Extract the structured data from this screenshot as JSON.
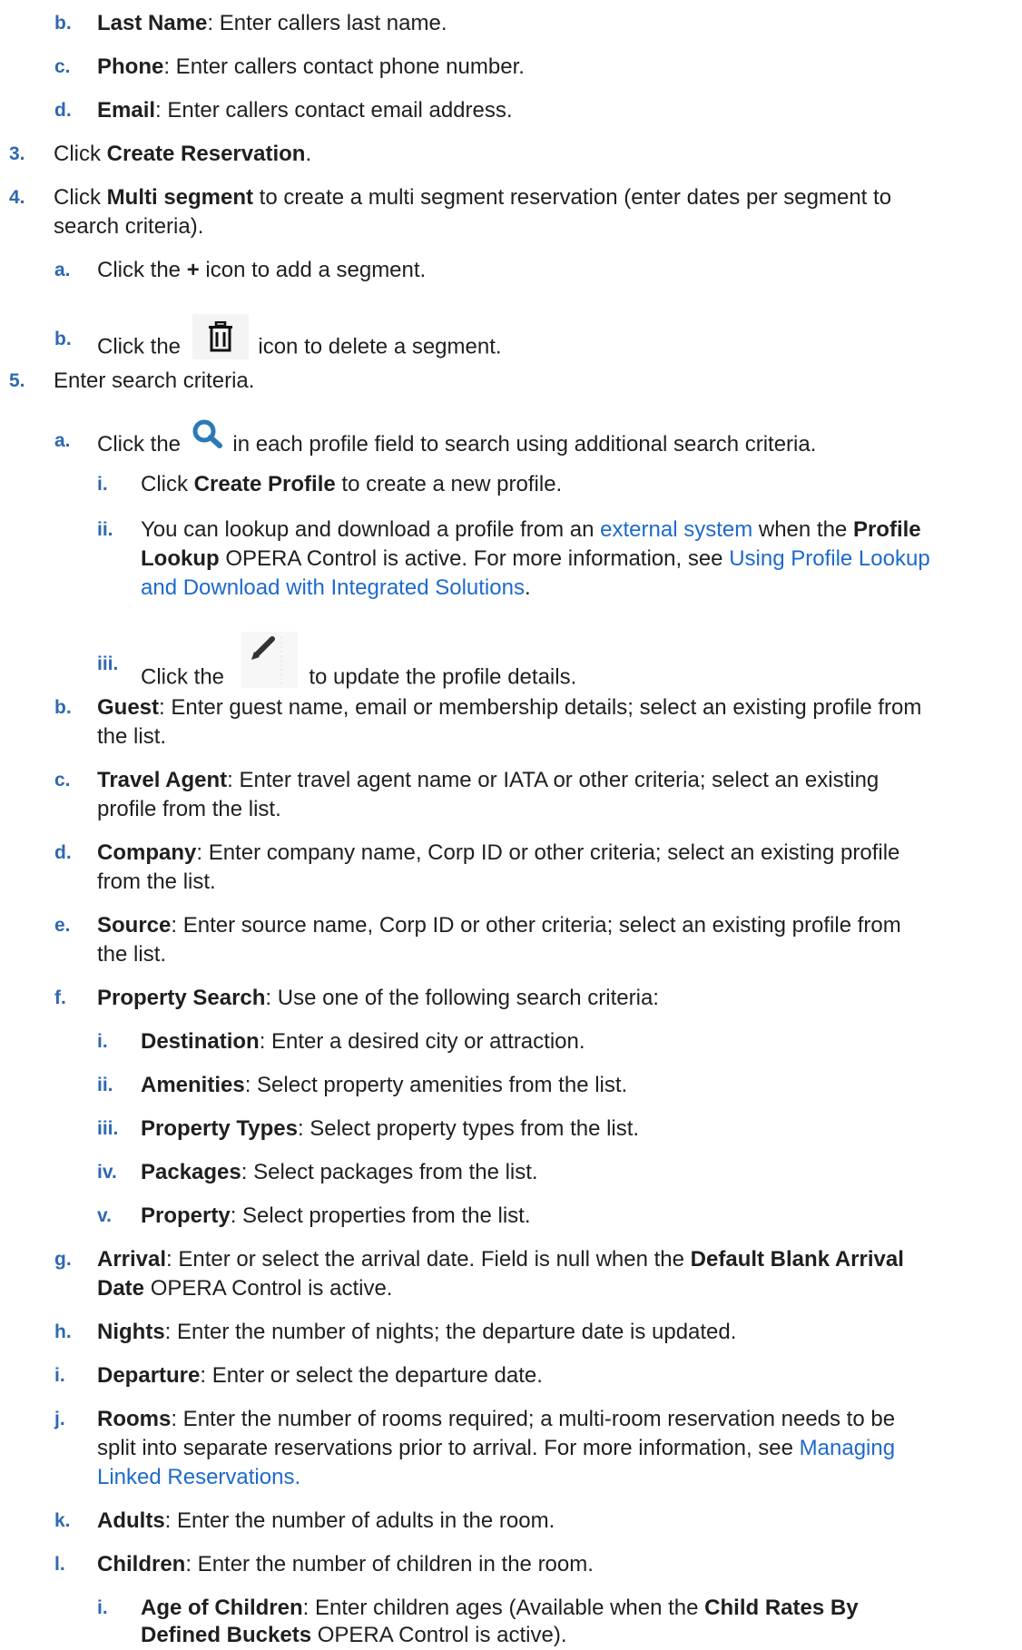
{
  "items": {
    "b_last": {
      "marker": "b.",
      "label": "Last Name",
      "text": ": Enter callers last name."
    },
    "c_phone": {
      "marker": "c.",
      "label": "Phone",
      "text": ": Enter callers contact phone number."
    },
    "d_email": {
      "marker": "d.",
      "label": "Email",
      "text": ": Enter callers contact email address."
    },
    "s3": {
      "marker": "3.",
      "pre": "Click ",
      "label": "Create Reservation",
      "post": "."
    },
    "s4": {
      "marker": "4.",
      "pre": "Click ",
      "label": "Multi segment",
      "post": " to create a multi segment reservation (enter dates per segment to",
      "line2": "search criteria)."
    },
    "s4a": {
      "marker": "a.",
      "pre": "Click the ",
      "label": "+",
      "post": " icon to add a segment."
    },
    "s4b": {
      "marker": "b.",
      "pre": "Click the",
      "post": "icon to delete a segment.",
      "icon": "trash-icon"
    },
    "s5": {
      "marker": "5.",
      "text": "Enter search criteria."
    },
    "s5a": {
      "marker": "a.",
      "pre": "Click the",
      "post": "in each profile field to search using additional search criteria.",
      "icon": "search-icon"
    },
    "s5ai": {
      "marker": "i.",
      "pre": "Click ",
      "label": "Create Profile",
      "post": " to create a new profile."
    },
    "s5aii": {
      "marker": "ii.",
      "l1_pre": "You can lookup and download a profile from an ",
      "l1_link": "external system",
      "l1_mid": " when the ",
      "l1_bold": "Profile",
      "l2_bold": "Lookup",
      "l2_mid": " OPERA Control is active. For more information, see ",
      "l2_link": "Using Profile Lookup",
      "l3_link": "and Download with Integrated Solutions",
      "l3_post": "."
    },
    "s5aiii": {
      "marker": "iii.",
      "pre": "Click the",
      "post": "to update the profile details.",
      "icon": "pencil-icon"
    },
    "s5b": {
      "marker": "b.",
      "label": "Guest",
      "text": ": Enter guest name, email or membership details; select an existing profile from",
      "line2": "the list."
    },
    "s5c": {
      "marker": "c.",
      "label": "Travel Agent",
      "text": ": Enter travel agent name or IATA or other criteria; select an existing",
      "line2": "profile from the list."
    },
    "s5d": {
      "marker": "d.",
      "label": "Company",
      "text": ": Enter company name, Corp ID or other criteria; select an existing profile",
      "line2": "from the list."
    },
    "s5e": {
      "marker": "e.",
      "label": "Source",
      "text": ": Enter source name, Corp ID or other criteria; select an existing profile from",
      "line2": "the list."
    },
    "s5f": {
      "marker": "f.",
      "label": "Property Search",
      "text": ": Use one of the following search criteria:"
    },
    "s5fi": {
      "marker": "i.",
      "label": "Destination",
      "text": ": Enter a desired city or attraction."
    },
    "s5fii": {
      "marker": "ii.",
      "label": "Amenities",
      "text": ": Select property amenities from the list."
    },
    "s5fiii": {
      "marker": "iii.",
      "label": "Property Types",
      "text": ": Select property types from the list."
    },
    "s5fiv": {
      "marker": "iv.",
      "label": "Packages",
      "text": ": Select packages from the list."
    },
    "s5fv": {
      "marker": "v.",
      "label": "Property",
      "text": ": Select properties from the list."
    },
    "s5g": {
      "marker": "g.",
      "label": "Arrival",
      "text": ": Enter or select the arrival date. Field is null when the ",
      "bold2": "Default Blank Arrival",
      "l2_bold": "Date",
      "l2_text": " OPERA Control is active."
    },
    "s5h": {
      "marker": "h.",
      "label": "Nights",
      "text": ": Enter the number of nights; the departure date is updated."
    },
    "s5i": {
      "marker": "i.",
      "label": "Departure",
      "text": ": Enter or select the departure date."
    },
    "s5j": {
      "marker": "j.",
      "label": "Rooms",
      "text": ": Enter the number of rooms required; a multi-room reservation needs to be",
      "line2_pre": "split into separate reservations prior to arrival. For more information, see ",
      "line2_link": "Managing",
      "line3_link": "Linked Reservations",
      "line3_post": "."
    },
    "s5k": {
      "marker": "k.",
      "label": "Adults",
      "text": ": Enter the number of adults in the room."
    },
    "s5l": {
      "marker": "l.",
      "label": "Children",
      "text": ": Enter the number of children in the room."
    },
    "s5li": {
      "marker": "i.",
      "label": "Age of Children",
      "text": ": Enter children ages (Available when the ",
      "bold2": "Child Rates By",
      "l2_bold": "Defined Buckets",
      "l2_text": " OPERA Control is active)."
    }
  }
}
